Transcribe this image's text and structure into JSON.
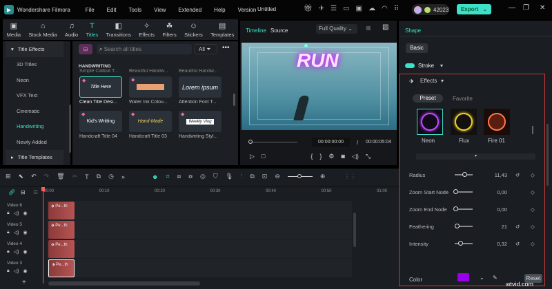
{
  "app": {
    "name": "Wondershare Filmora",
    "document": "Untitled",
    "credits": "42023",
    "export_label": "Export"
  },
  "menu": [
    "File",
    "Edit",
    "Tools",
    "View",
    "Extended",
    "Help",
    "Version"
  ],
  "media_tabs": [
    {
      "label": "Media",
      "icon": "▣"
    },
    {
      "label": "Stock Media",
      "icon": "⌂"
    },
    {
      "label": "Audio",
      "icon": "♫"
    },
    {
      "label": "Titles",
      "icon": "T"
    },
    {
      "label": "Transitions",
      "icon": "◧"
    },
    {
      "label": "Effects",
      "icon": "✧"
    },
    {
      "label": "Filters",
      "icon": "☘"
    },
    {
      "label": "Stickers",
      "icon": "☺"
    },
    {
      "label": "Templates",
      "icon": "▤"
    }
  ],
  "sidebar": {
    "title_effects": "Title Effects",
    "items": [
      "3D Titles",
      "Neon",
      "VFX Text",
      "Cinematic",
      "Handwriting",
      "Newly Added"
    ],
    "title_templates": "Title Templates"
  },
  "titles": {
    "search_placeholder": "Search all titles",
    "filter": "All",
    "section": "HANDWRITING",
    "partial_row": [
      "Simple Callout T...",
      "Beautiful Handw...",
      "Beautiful Handw..."
    ],
    "items": [
      {
        "thumb": "Title Here",
        "label": "Clean Title Desi..."
      },
      {
        "thumb": "",
        "label": "Water Ink Colou..."
      },
      {
        "thumb": "Lorem ipsum",
        "label": "Attention Font T..."
      },
      {
        "thumb": "Kid's Writting",
        "label": "Handcraft Title 04"
      },
      {
        "thumb": "Hand-Made",
        "label": "Handcraft Title 03"
      },
      {
        "thumb": "Weekly Vlog",
        "label": "Handwriting Styl..."
      }
    ]
  },
  "preview": {
    "tab_timeline": "Timeline",
    "tab_source": "Source",
    "quality": "Full Quality",
    "overlay_text": "RUN",
    "current_time": "00:00:00:00",
    "separator": "/",
    "total_time": "00:00:05:04"
  },
  "inspector": {
    "header": "Shape",
    "basic_tab": "Basic",
    "stroke_label": "Stroke",
    "effects_label": "Effects",
    "preset_tab": "Preset",
    "favorite_tab": "Favorite",
    "presets": [
      {
        "name": "Neon",
        "color": "#c04cff"
      },
      {
        "name": "Flux",
        "color": "#f5d020"
      },
      {
        "name": "Fire 01",
        "color": "#ff7a4a"
      }
    ],
    "params": [
      {
        "label": "Radius",
        "value": "11,43",
        "level": 0.6,
        "reset": true
      },
      {
        "label": "Zoom Start Node",
        "value": "0,00",
        "level": 0,
        "reset": false
      },
      {
        "label": "Zoom End Node",
        "value": "0,00",
        "level": 0,
        "reset": false
      },
      {
        "label": "Feathering",
        "value": "21",
        "level": 0.1,
        "reset": true
      },
      {
        "label": "Intensity",
        "value": "0,32",
        "level": 0.32,
        "reset": true
      }
    ],
    "color_label": "Color",
    "color_value": "#9a00e8",
    "reset_label": "Reset"
  },
  "timeline": {
    "ruler": [
      "00:00",
      "00:10",
      "00:20",
      "00:30",
      "00:40",
      "00:50",
      "01:00"
    ],
    "tracks": [
      {
        "name": "Video 6",
        "clip": "Pe...th"
      },
      {
        "name": "Video 5",
        "clip": "Pe...th"
      },
      {
        "name": "Video 4",
        "clip": "Pe...th"
      },
      {
        "name": "Video 3",
        "clip": "Pe...th"
      }
    ]
  },
  "watermark": "wtvid.com"
}
